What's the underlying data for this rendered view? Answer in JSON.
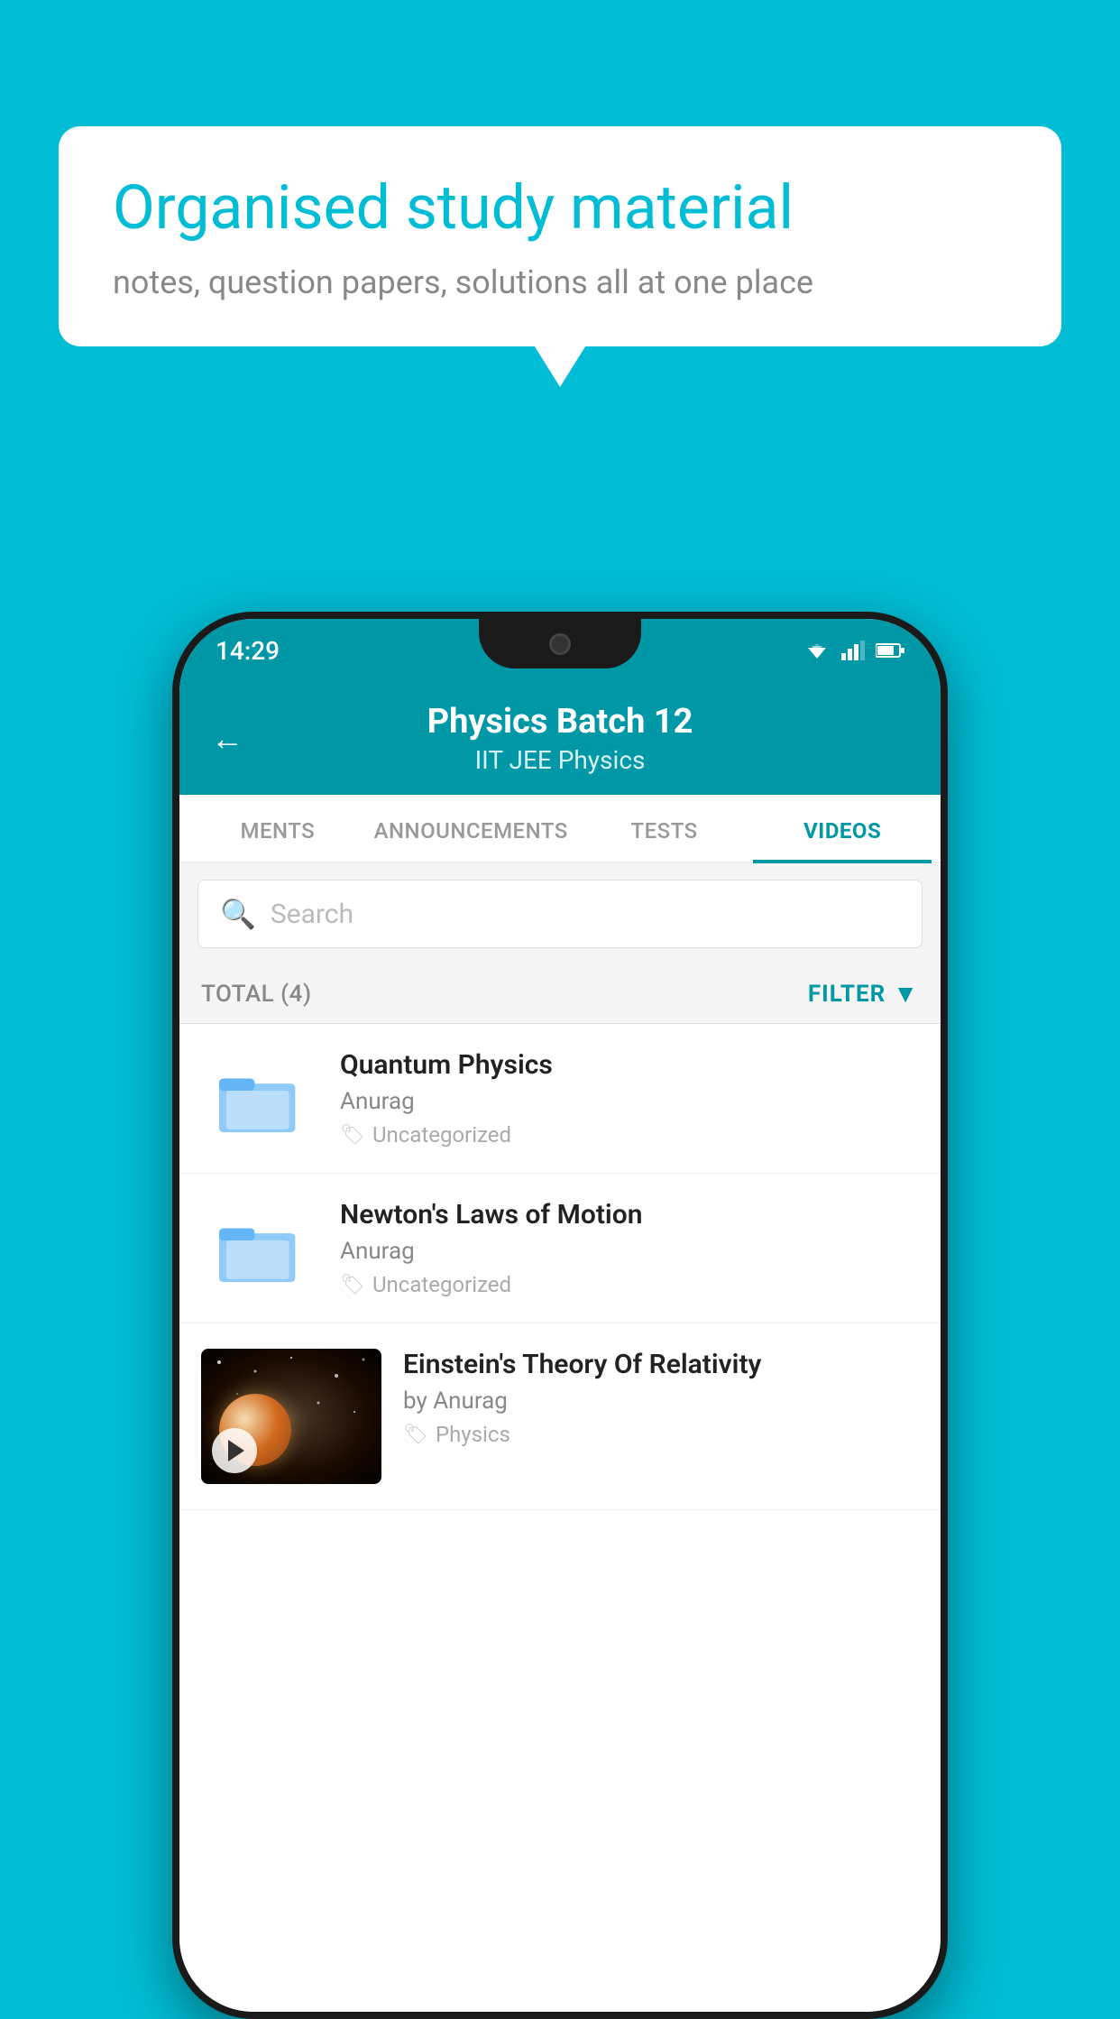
{
  "background_color": "#00BCD4",
  "speech_bubble": {
    "title": "Organised study material",
    "subtitle": "notes, question papers, solutions all at one place"
  },
  "status_bar": {
    "time": "14:29"
  },
  "header": {
    "title": "Physics Batch 12",
    "subtitle": "IIT JEE   Physics",
    "back_label": "←"
  },
  "tabs": [
    {
      "label": "MENTS",
      "active": false
    },
    {
      "label": "ANNOUNCEMENTS",
      "active": false
    },
    {
      "label": "TESTS",
      "active": false
    },
    {
      "label": "VIDEOS",
      "active": true
    }
  ],
  "search": {
    "placeholder": "Search"
  },
  "filter_row": {
    "total_label": "TOTAL (4)",
    "filter_label": "FILTER"
  },
  "videos": [
    {
      "title": "Quantum Physics",
      "author": "Anurag",
      "tag": "Uncategorized",
      "type": "folder"
    },
    {
      "title": "Newton's Laws of Motion",
      "author": "Anurag",
      "tag": "Uncategorized",
      "type": "folder"
    },
    {
      "title": "Einstein's Theory Of Relativity",
      "author": "by Anurag",
      "tag": "Physics",
      "type": "video"
    }
  ]
}
